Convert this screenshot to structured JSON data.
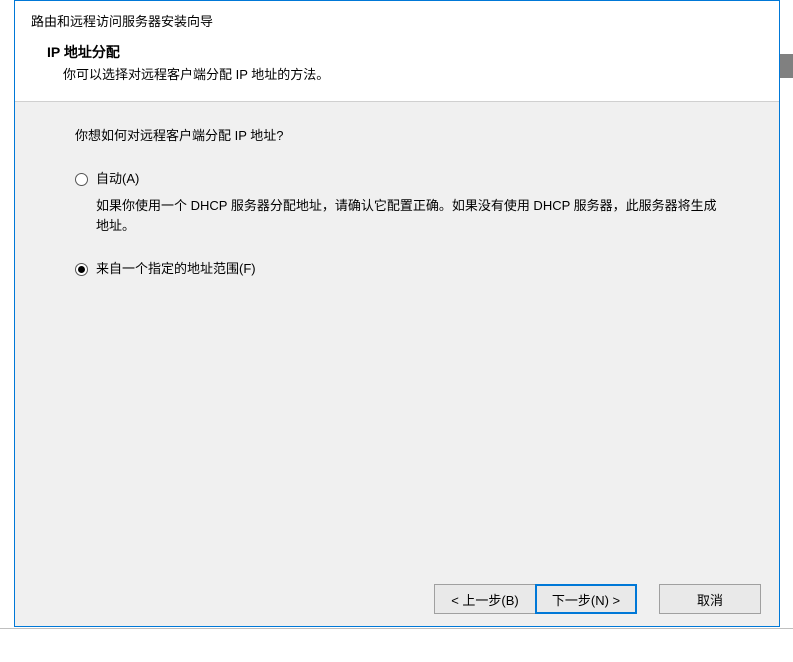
{
  "wizard": {
    "title": "路由和远程访问服务器安装向导",
    "heading": "IP 地址分配",
    "subheading": "你可以选择对远程客户端分配 IP 地址的方法。"
  },
  "body": {
    "question": "你想如何对远程客户端分配 IP 地址?"
  },
  "options": {
    "automatic": {
      "label": "自动(A)",
      "description": "如果你使用一个 DHCP 服务器分配地址，请确认它配置正确。如果没有使用 DHCP 服务器，此服务器将生成地址。",
      "checked": false
    },
    "fromRange": {
      "label": "来自一个指定的地址范围(F)",
      "checked": true
    }
  },
  "buttons": {
    "back": "< 上一步(B)",
    "next": "下一步(N) >",
    "cancel": "取消"
  }
}
